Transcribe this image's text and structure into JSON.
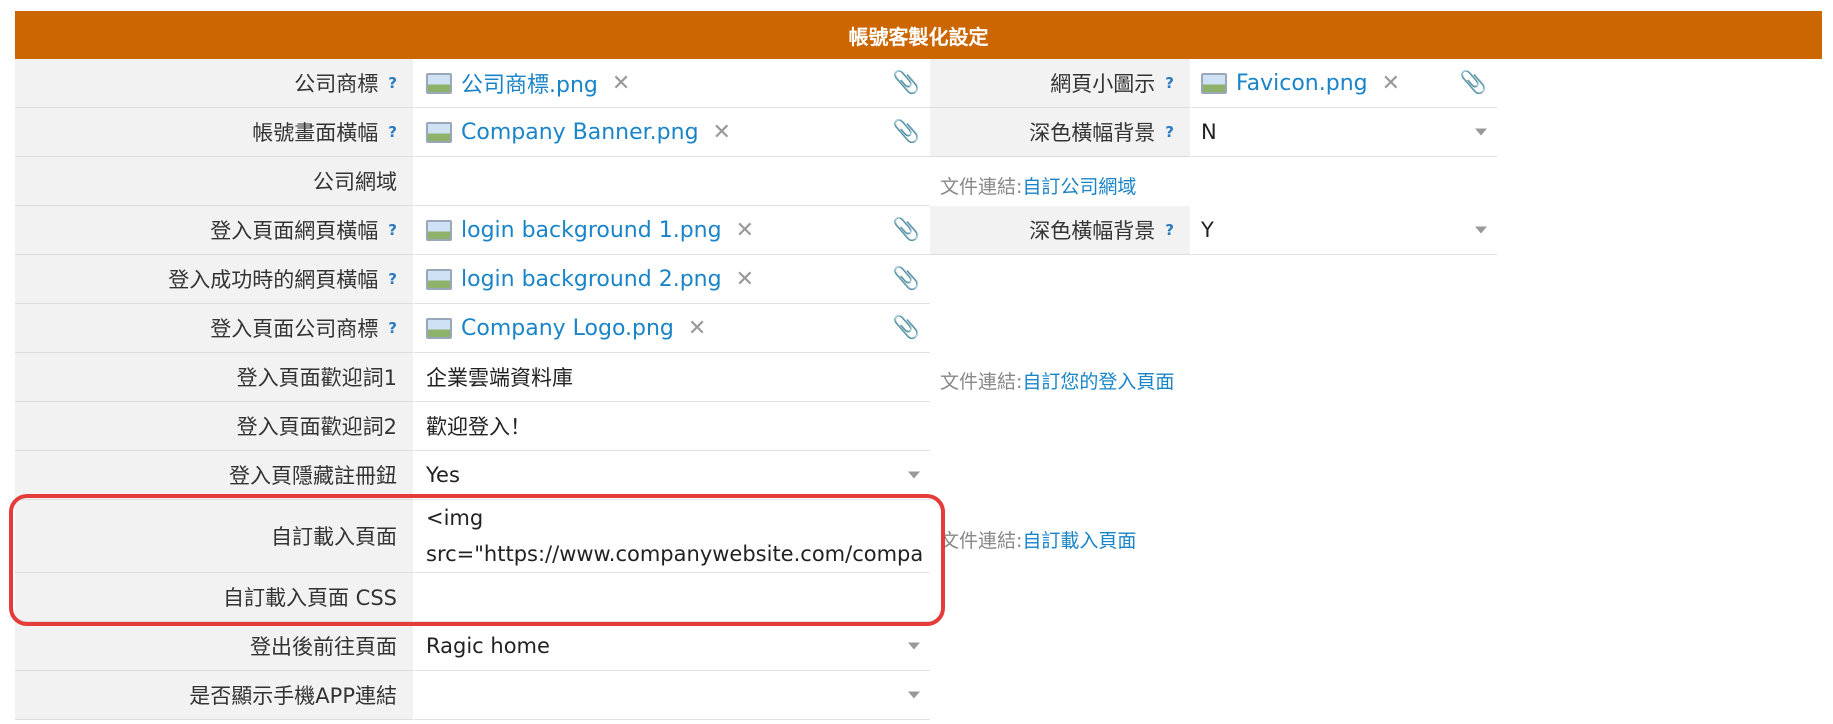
{
  "title": "帳號客製化設定",
  "rows": [
    {
      "label": "公司商標",
      "file": "公司商標.png"
    },
    {
      "label": "帳號畫面橫幅",
      "file": "Company Banner.png"
    },
    {
      "label": "公司網域",
      "value": ""
    },
    {
      "label": "登入頁面網頁橫幅",
      "file": "login background 1.png"
    },
    {
      "label": "登入成功時的網頁橫幅",
      "file": "login background 2.png"
    },
    {
      "label": "登入頁面公司商標",
      "file": "Company Logo.png"
    },
    {
      "label": "登入頁面歡迎詞1",
      "value": "企業雲端資料庫"
    },
    {
      "label": "登入頁面歡迎詞2",
      "value": "歡迎登入！"
    },
    {
      "label": "登入頁隱藏註冊鈕",
      "value": "Yes"
    },
    {
      "label": "自訂載入頁面",
      "value_line1": "<img",
      "value_line2": "src=\"https://www.companywebsite.com/compa"
    },
    {
      "label": "自訂載入頁面 CSS",
      "value": ""
    },
    {
      "label": "登出後前往頁面",
      "value": "Ragic home"
    },
    {
      "label": "是否顯示手機APP連結",
      "value": ""
    }
  ],
  "right": {
    "favicon_label": "網頁小圖示",
    "favicon_file": "Favicon.png",
    "dark_banner_label_1": "深色橫幅背景",
    "dark_banner_value_1": "N",
    "dark_banner_label_2": "深色橫幅背景",
    "dark_banner_value_2": "Y"
  },
  "notes": {
    "prefix": "文件連結:",
    "domain_link": "自訂公司網域",
    "login_link": "自訂您的登入頁面",
    "loading_link": "自訂載入頁面"
  },
  "icons": {
    "help": "?",
    "remove": "✕",
    "attach": "📎"
  },
  "colors": {
    "header": "#cc6600",
    "link": "#1a84c8",
    "highlight": "#e53b3b"
  }
}
